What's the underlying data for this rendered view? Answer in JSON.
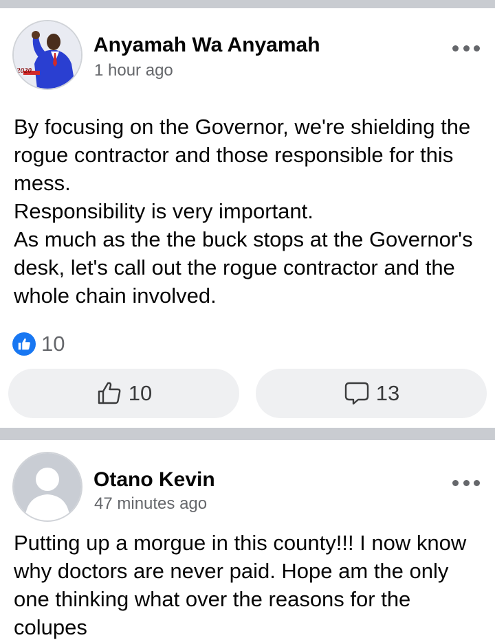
{
  "posts": [
    {
      "author": "Anyamah Wa Anyamah",
      "timestamp": "1 hour ago",
      "avatar_badge": "2020",
      "body_lines": [
        "By focusing on the Governor, we're shielding the rogue contractor and those responsible for this mess.",
        "Responsibility is very important.",
        "As much as the the buck stops at the Governor's desk, let's call out the rogue contractor and the whole chain involved."
      ],
      "reaction_count": "10",
      "like_count": "10",
      "comment_count": "13"
    },
    {
      "author": "Otano Kevin",
      "timestamp": "47 minutes ago",
      "body_lines": [
        "Putting up a morgue in this county!!! I now know why doctors are never paid. Hope am the only one thinking what over the reasons for the colupes"
      ]
    }
  ],
  "icons": {
    "more": "more-icon",
    "like": "thumbs-up-icon",
    "comment": "comment-icon",
    "reaction": "like-reaction-icon"
  },
  "colors": {
    "like_blue": "#1877f2",
    "divider": "#c9ccd1",
    "pill_bg": "#eff0f2",
    "meta_text": "#65676b"
  }
}
